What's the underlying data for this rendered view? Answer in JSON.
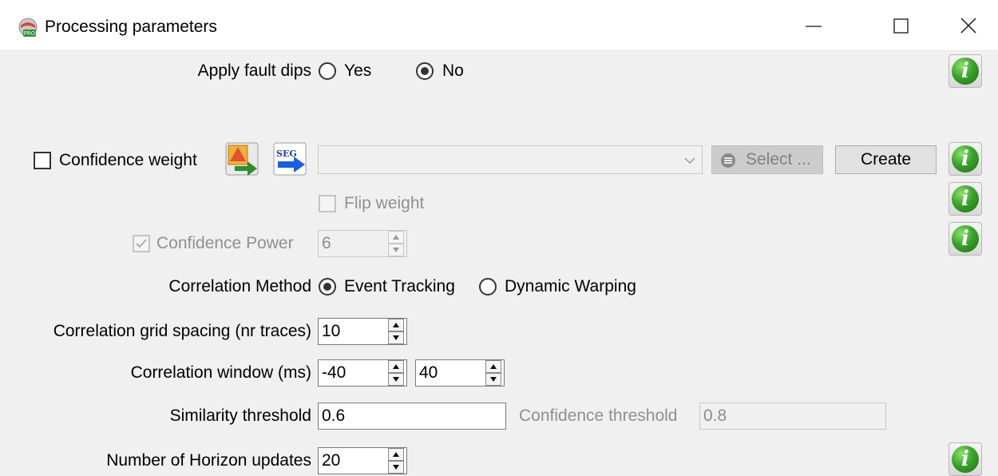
{
  "window": {
    "title": "Processing parameters",
    "app_icon": "pro-app-icon",
    "controls": [
      "minimize-icon",
      "maximize-icon",
      "close-icon"
    ]
  },
  "fault_dips": {
    "label": "Apply fault dips",
    "options": [
      "Yes",
      "No"
    ],
    "selected": "No"
  },
  "confidence_weight": {
    "label": "Confidence weight",
    "checked": false,
    "icons": [
      "import-weight-icon",
      "seg-import-icon"
    ],
    "combo_value": "",
    "select_label": "Select ...",
    "create_label": "Create"
  },
  "flip_weight": {
    "label": "Flip weight",
    "checked": false,
    "enabled": false
  },
  "confidence_power": {
    "label": "Confidence Power",
    "checked": true,
    "enabled": false,
    "value": "6"
  },
  "correlation_method": {
    "label": "Correlation Method",
    "options": [
      "Event Tracking",
      "Dynamic Warping"
    ],
    "selected": "Event Tracking"
  },
  "grid_spacing": {
    "label": "Correlation grid spacing (nr traces)",
    "value": "10"
  },
  "window_ms": {
    "label": "Correlation window (ms)",
    "start": "-40",
    "end": "40"
  },
  "similarity": {
    "label": "Similarity threshold",
    "value": "0.6"
  },
  "confidence_threshold": {
    "label": "Confidence threshold",
    "value": "0.8",
    "enabled": false
  },
  "horizon_updates": {
    "label": "Number of Horizon updates",
    "value": "20"
  },
  "info_glyph": "i",
  "colors": {
    "info_green": "#3aa32a",
    "background": "#f0f0f0"
  }
}
